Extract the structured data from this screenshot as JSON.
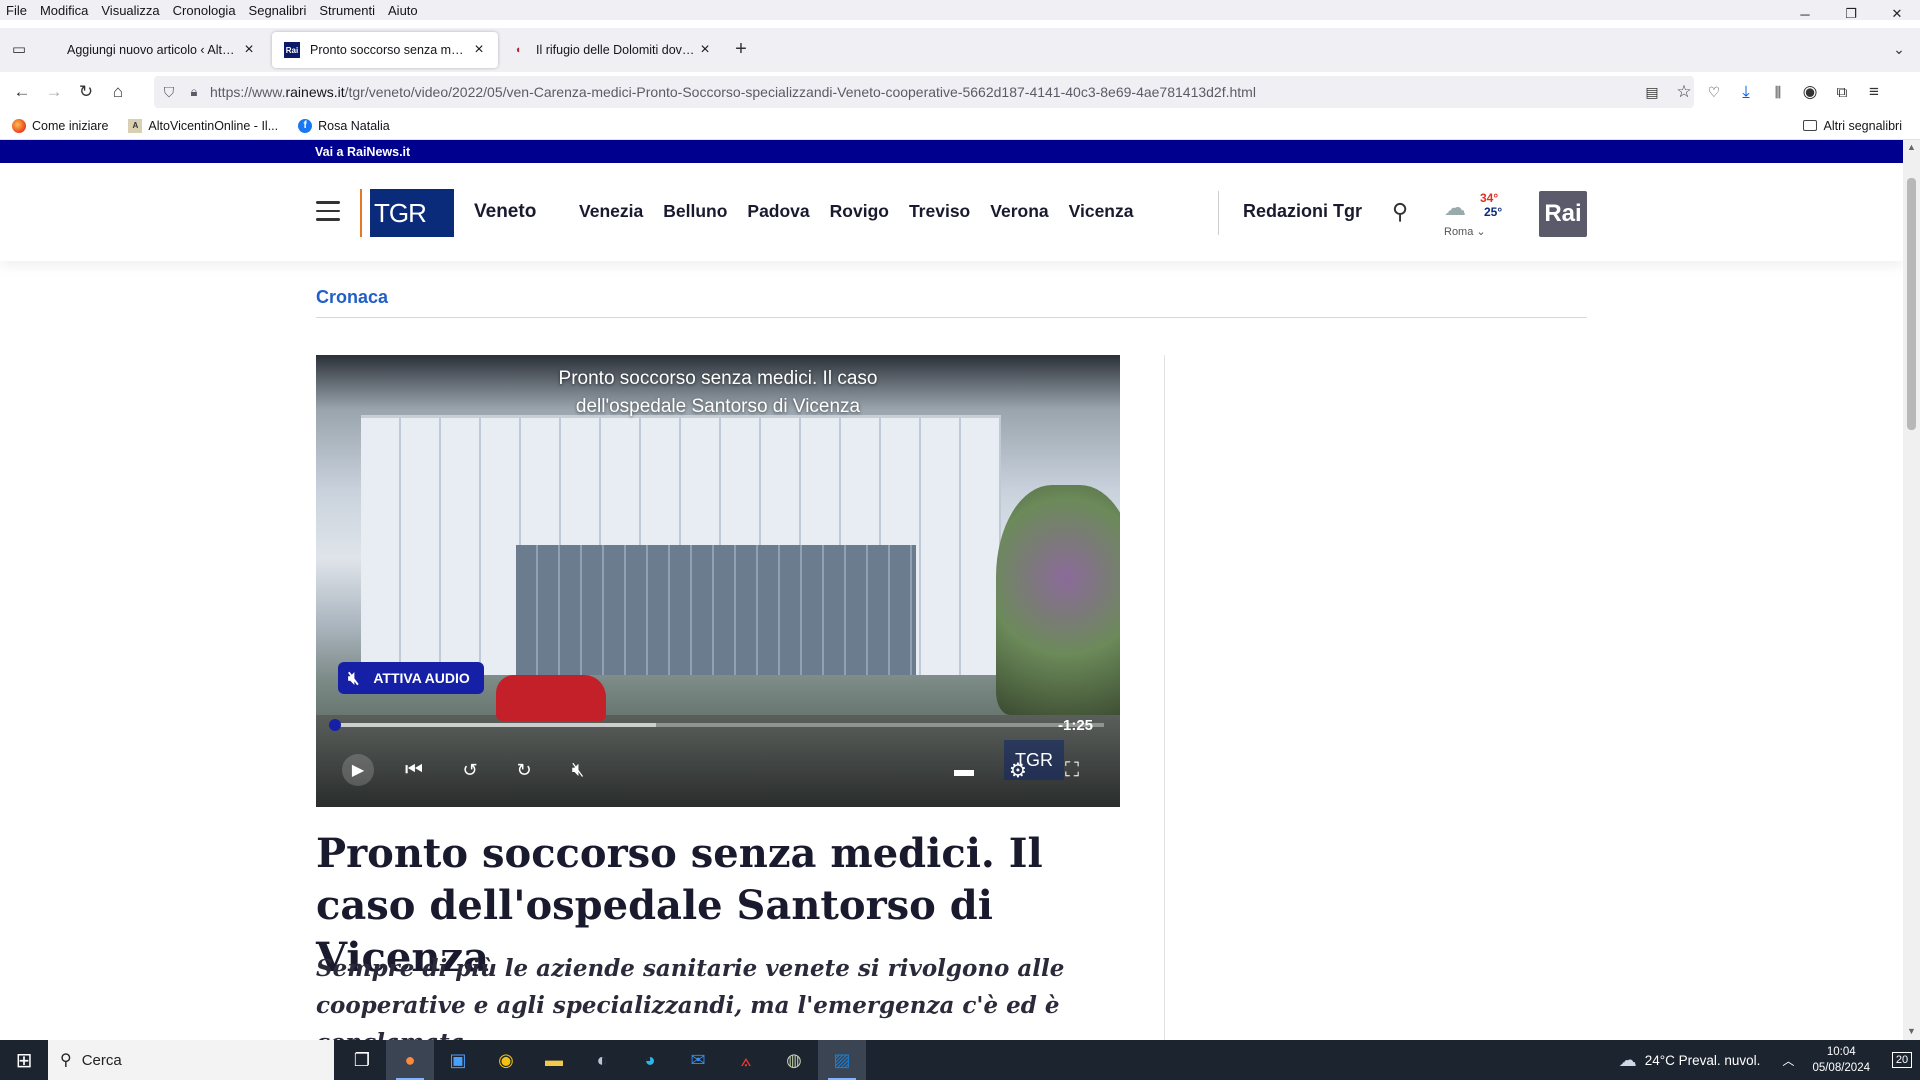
{
  "menubar": {
    "items": [
      "File",
      "Modifica",
      "Visualizza",
      "Cronologia",
      "Segnalibri",
      "Strumenti",
      "Aiuto"
    ]
  },
  "window_controls": {
    "minimize": "─",
    "restore": "❐",
    "close": "✕"
  },
  "tabs": [
    {
      "title": "Aggiungi nuovo articolo ‹ AltoVicentinOnline",
      "favicon": "wordpress-icon",
      "active": false
    },
    {
      "title": "Pronto soccorso senza medici. Il caso",
      "favicon": "rai-icon",
      "active": true
    },
    {
      "title": "Il rifugio delle Dolomiti dove in",
      "favicon": "lips-icon",
      "active": false
    }
  ],
  "toolbar": {
    "url_prefix": "https://www.",
    "url_host": "rainews.it",
    "url_path": "/tgr/veneto/video/2022/05/ven-Carenza-medici-Pronto-Soccorso-specializzandi-Veneto-cooperative-5662d187-4141-40c3-8e69-4ae781413d2f.html"
  },
  "bookmarks": {
    "items": [
      {
        "label": "Come iniziare",
        "icon": "firefox-icon"
      },
      {
        "label": "AltoVicentinOnline - Il...",
        "icon": "site-icon"
      },
      {
        "label": "Rosa Natalia",
        "icon": "facebook-icon"
      }
    ],
    "other": "Altri segnalibri"
  },
  "site": {
    "top_link": "Vai a RaiNews.it",
    "logo_text": "TGR",
    "region": "Veneto",
    "cities": [
      "Venezia",
      "Belluno",
      "Padova",
      "Rovigo",
      "Treviso",
      "Verona",
      "Vicenza"
    ],
    "redazioni": "Redazioni Tgr",
    "weather": {
      "max": "34°",
      "min": "25°",
      "city": "Roma"
    },
    "rai_logo": "Rai",
    "colors": {
      "rai_blue": "#00008f",
      "section_blue": "#2060c8",
      "audio_button": "#1520a6"
    }
  },
  "article": {
    "section": "Cronaca",
    "video_title_line1": "Pronto soccorso senza medici. Il caso",
    "video_title_line2": "dell'ospedale Santorso di Vicenza",
    "audio_button": "ATTIVA AUDIO",
    "time_remaining": "-1:25",
    "progress": 0.0,
    "buffered": 0.42,
    "watermark": "TGR",
    "title": "Pronto soccorso senza medici. Il caso dell'ospedale Santorso di Vicenza",
    "subtitle": "Sempre di più le aziende sanitarie venete si rivolgono alle cooperative e agli specializzandi, ma l'emergenza c'è ed è conclamata"
  },
  "taskbar": {
    "search_placeholder": "Cerca",
    "weather": "24°C  Preval. nuvol.",
    "time": "10:04",
    "date": "05/08/2024",
    "notifications": "20"
  }
}
